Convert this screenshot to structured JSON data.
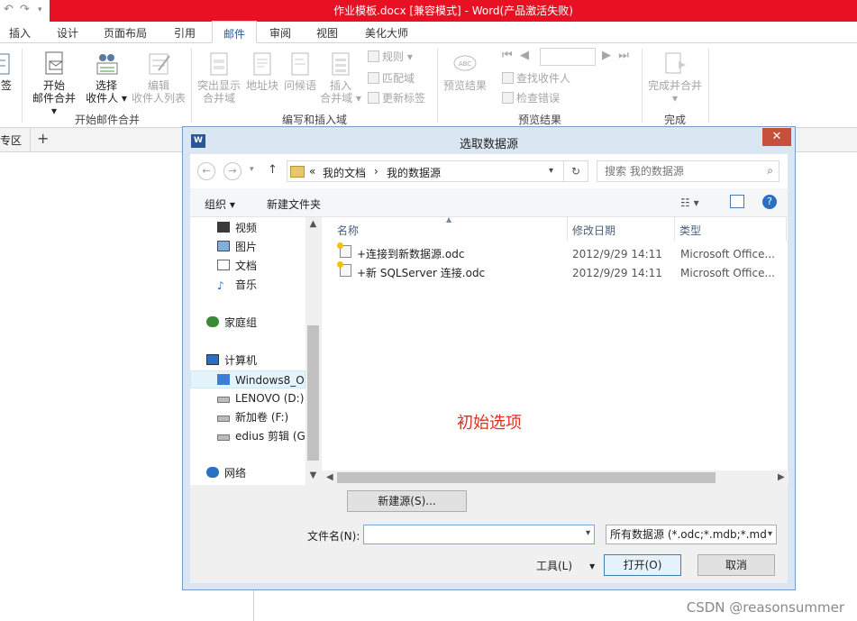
{
  "window": {
    "title": "作业模板.docx [兼容模式] - Word(产品激活失败)"
  },
  "tabs": [
    {
      "label": "插入"
    },
    {
      "label": "设计"
    },
    {
      "label": "页面布局"
    },
    {
      "label": "引用"
    },
    {
      "label": "邮件"
    },
    {
      "label": "审阅"
    },
    {
      "label": "视图"
    },
    {
      "label": "美化大师"
    }
  ],
  "ribbon": {
    "partial_left": "签",
    "start_merge": {
      "line1": "开始",
      "line2": "邮件合并"
    },
    "select_recipients": {
      "line1": "选择",
      "line2": "收件人"
    },
    "edit_recipients": {
      "line1": "编辑",
      "line2": "收件人列表"
    },
    "group_start": "开始邮件合并",
    "highlight": {
      "line1": "突出显示",
      "line2": "合并域"
    },
    "address_block": "地址块",
    "greeting": "问候语",
    "insert_field": {
      "line1": "插入",
      "line2": "合并域"
    },
    "rules": "规则",
    "match_fields": "匹配域",
    "update_labels": "更新标签",
    "group_write": "编写和插入域",
    "preview_results": "预览结果",
    "find_recipient": "查找收件人",
    "check_errors": "检查错误",
    "group_preview": "预览结果",
    "finish_merge": "完成并合并",
    "group_finish": "完成"
  },
  "docbar": {
    "partial_left": "专区",
    "plus": "+"
  },
  "dialog": {
    "title": "选取数据源",
    "address": {
      "chevron": "«",
      "crumb1": "我的文档",
      "sep": "›",
      "crumb2": "我的数据源"
    },
    "search_placeholder": "搜索 我的数据源",
    "toolbar": {
      "organize": "组织",
      "new_folder": "新建文件夹"
    },
    "nav_items": [
      {
        "label": "视频"
      },
      {
        "label": "图片"
      },
      {
        "label": "文档"
      },
      {
        "label": "音乐"
      },
      {
        "label": "家庭组"
      },
      {
        "label": "计算机"
      },
      {
        "label": "Windows8_O"
      },
      {
        "label": "LENOVO (D:)"
      },
      {
        "label": "新加卷 (F:)"
      },
      {
        "label": "edius 剪辑 (G"
      },
      {
        "label": "网络"
      }
    ],
    "columns": {
      "name": "名称",
      "modified": "修改日期",
      "type": "类型"
    },
    "files": [
      {
        "name": "+连接到新数据源.odc",
        "modified": "2012/9/29 14:11",
        "type": "Microsoft Office..."
      },
      {
        "name": "+新 SQLServer 连接.odc",
        "modified": "2012/9/29 14:11",
        "type": "Microsoft Office..."
      }
    ],
    "annotation": "初始选项",
    "new_source_button": "新建源(S)...",
    "filename_label": "文件名(N):",
    "filename_value": "",
    "filetype_value": "所有数据源 (*.odc;*.mdb;*.md",
    "tools_label": "工具(L)",
    "open_button": "打开(O)",
    "cancel_button": "取消"
  },
  "watermark": "CSDN @reasonsummer",
  "colors": {
    "titlebar_red": "#e81123",
    "accent": "#2b579a",
    "annotation": "#e0301e"
  }
}
